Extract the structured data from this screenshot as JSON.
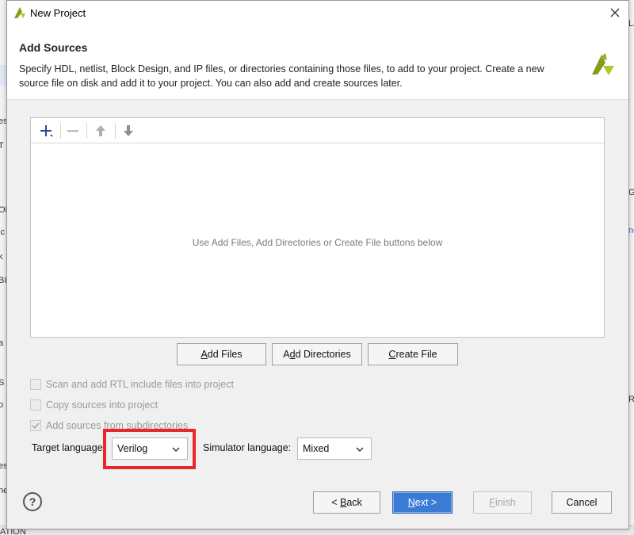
{
  "background": {
    "left_fragments": [
      "es",
      "T",
      "OR",
      "ic",
      "k",
      "BI",
      "a",
      "S",
      "o",
      "es",
      "he",
      "ATION"
    ],
    "right_fragments": [
      "La",
      "G",
      "ne",
      "Ro"
    ]
  },
  "window": {
    "title": "New Project",
    "logo_icon": "vivado-logo-icon",
    "close_icon": "close-icon"
  },
  "header": {
    "title": "Add Sources",
    "description": "Specify HDL, netlist, Block Design, and IP files, or directories containing those files, to add to your project. Create a new source file on disk and add it to your project. You can also add and create sources later."
  },
  "toolbar": {
    "add_icon": "plus-icon",
    "remove_icon": "minus-icon",
    "move_up_icon": "arrow-up-icon",
    "move_down_icon": "arrow-down-icon"
  },
  "panel": {
    "empty_message": "Use Add Files, Add Directories or Create File buttons below"
  },
  "actions": {
    "add_files": {
      "prefix": "",
      "mnemonic": "A",
      "rest": "dd Files"
    },
    "add_directories": {
      "prefix": "A",
      "mnemonic": "d",
      "rest": "d Directories"
    },
    "create_file": {
      "prefix": "",
      "mnemonic": "C",
      "rest": "reate File"
    }
  },
  "options": [
    {
      "label": "Scan and add RTL include files into project",
      "checked": false,
      "enabled": false
    },
    {
      "label": "Copy sources into project",
      "checked": false,
      "enabled": false
    },
    {
      "label": "Add sources from subdirectories",
      "checked": true,
      "enabled": false
    }
  ],
  "language": {
    "target_label": "Target language:",
    "target_value": "Verilog",
    "simulator_label": "Simulator language:",
    "simulator_value": "Mixed",
    "highlight_color": "#e8262d"
  },
  "footer": {
    "help_label": "?",
    "back": {
      "prefix": "< ",
      "mnemonic": "B",
      "rest": "ack"
    },
    "next": {
      "prefix": "",
      "mnemonic": "N",
      "rest": "ext >"
    },
    "finish": {
      "prefix": "",
      "mnemonic": "F",
      "rest": "inish"
    },
    "cancel": "Cancel",
    "next_color": "#3a7bd5"
  }
}
